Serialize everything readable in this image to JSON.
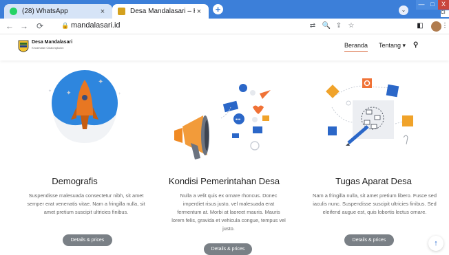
{
  "browser": {
    "tabs": [
      {
        "title": "(28) WhatsApp",
        "close": "×",
        "favicon_color": "#25d366"
      },
      {
        "title": "Desa Mandalasari – Kecamatan K",
        "close": "×",
        "favicon_color": "#d4a11e"
      }
    ],
    "new_tab": "+",
    "tab_search": "⌄",
    "window_controls": {
      "minimize": "—",
      "maximize": "□",
      "close": "X"
    },
    "cloud_tag": "Cl",
    "nav": {
      "back": "←",
      "forward": "→",
      "reload": "⟳"
    },
    "url": "mandalasari.id",
    "lock_icon": "🔒",
    "toolbar_icons": {
      "translate": "⇄",
      "zoom": "🔍",
      "share": "⇪",
      "bookmark": "☆",
      "sidepanel": "◧",
      "menu": "⋮"
    }
  },
  "site": {
    "brand_name": "Desa Mandalasari",
    "brand_sub": "Kecamatan Cikalongkulon",
    "menu": {
      "home": "Beranda",
      "about": "Tentang ▾",
      "search": "⚲"
    },
    "accent_color": "#d9693e"
  },
  "columns": [
    {
      "title": "Demografis",
      "text": "Suspendisse malesuada consectetur nibh, sit amet semper erat venenatis vitae. Nam a fringilla nulla, sit amet pretium suscipit ultricies finibus.",
      "button": "Details & prices"
    },
    {
      "title": "Kondisi Pemerintahan Desa",
      "text": "Nulla a velit quis ex ornare rhoncus. Donec imperdiet risus justo, vel malesuada erat fermentum at. Morbi at laoreet mauris. Mauris lorem felis, gravida et vehicula congue, tempus vel justo.",
      "button": "Details & prices"
    },
    {
      "title": "Tugas Aparat Desa",
      "text": "Nam a fringilla nulla, sit amet pretium libero. Fusce sed iaculis nunc. Suspendisse suscipit ultricies finibus. Sed eleifend augue est, quis lobortis lectus ornare.",
      "button": "Details & prices"
    }
  ],
  "back_to_top": "↑"
}
